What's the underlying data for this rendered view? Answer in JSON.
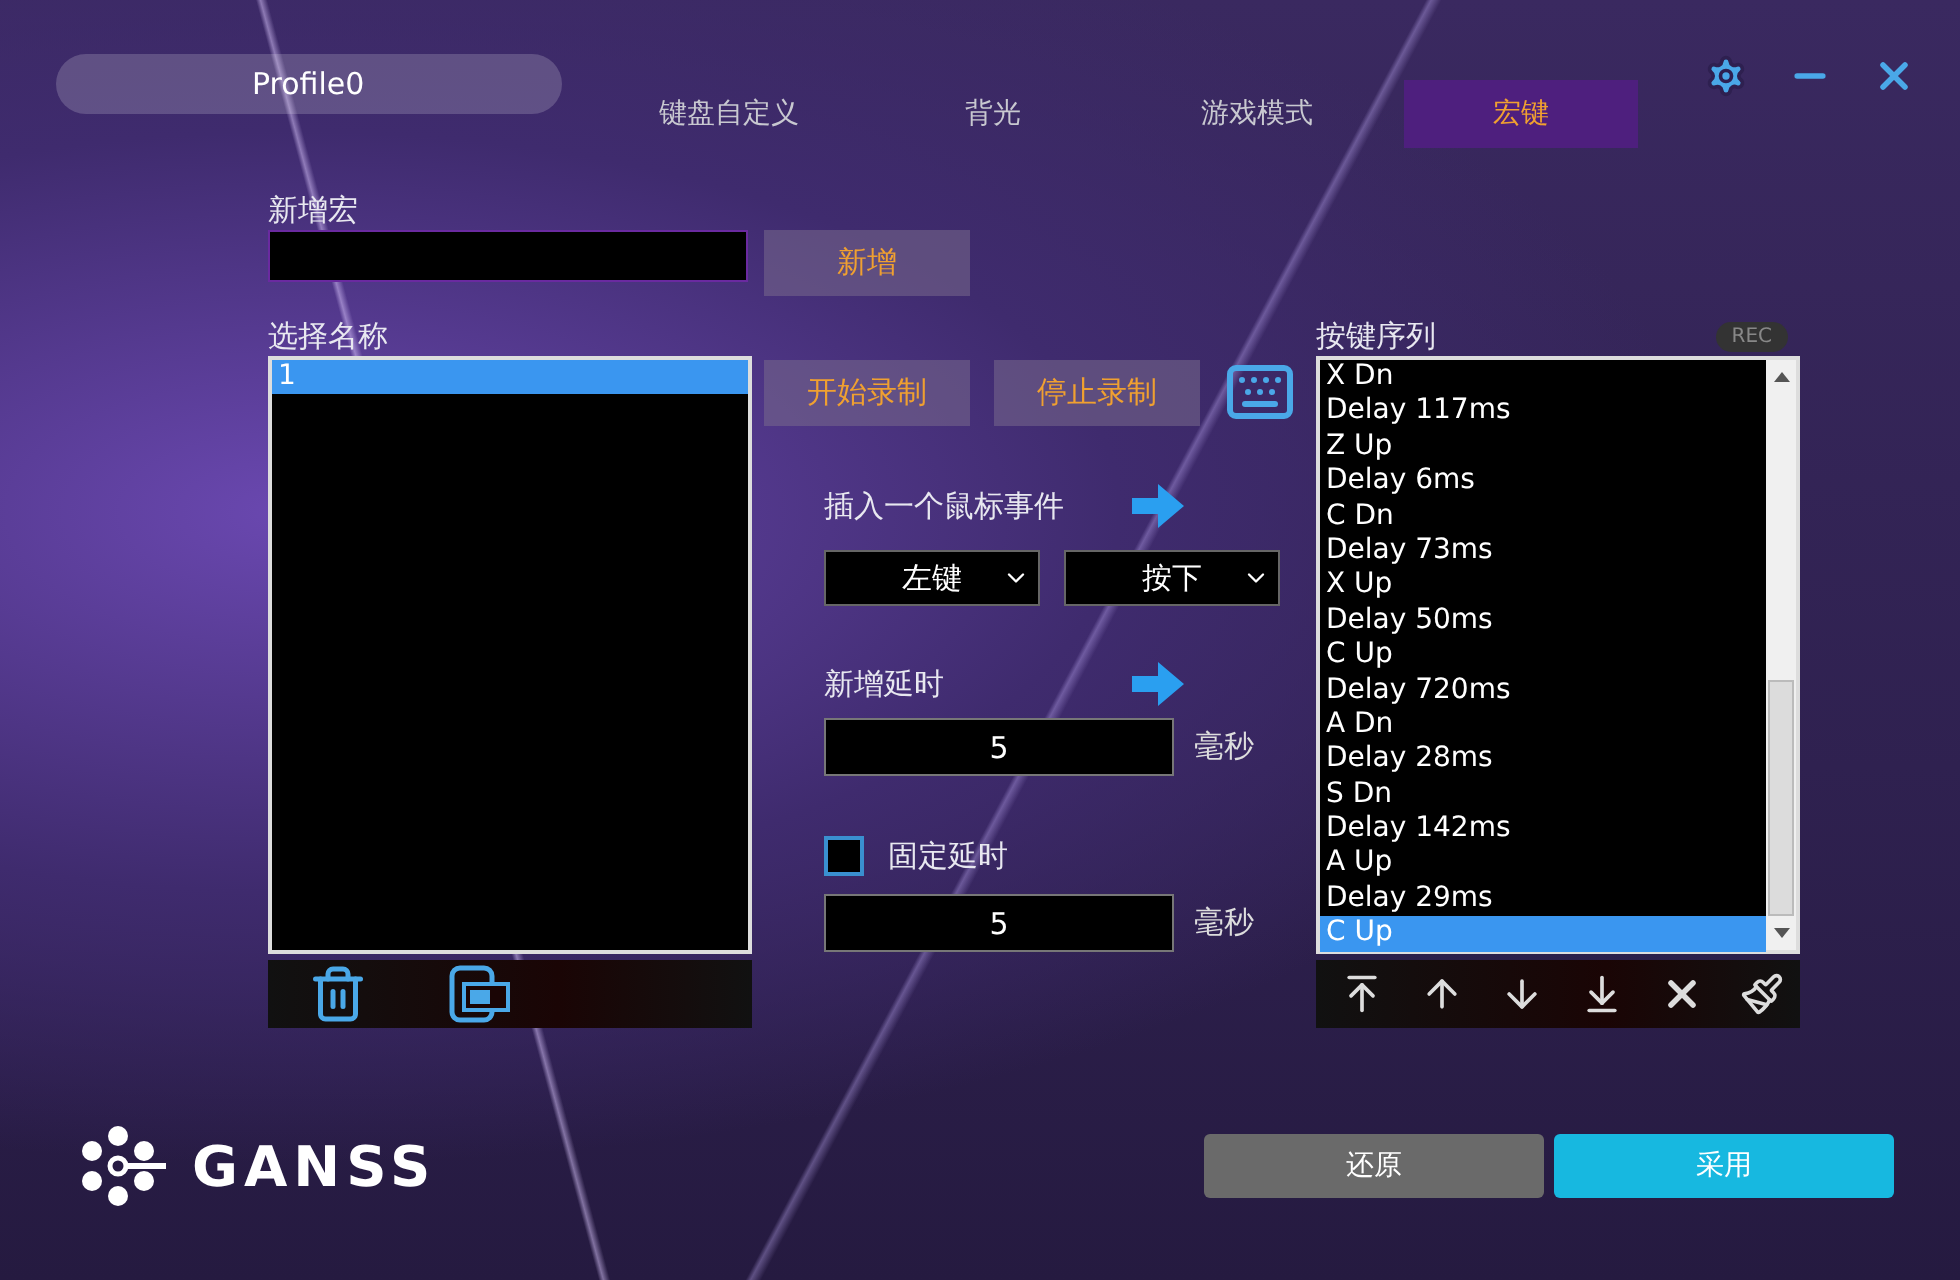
{
  "profile": {
    "name": "Profile0"
  },
  "tabs": [
    {
      "label": "键盘自定义",
      "selected": false
    },
    {
      "label": "背光",
      "selected": false
    },
    {
      "label": "游戏模式",
      "selected": false
    },
    {
      "label": "宏键",
      "selected": true
    }
  ],
  "new_macro": {
    "label": "新增宏",
    "button": "新增"
  },
  "macro_list": {
    "label": "选择名称",
    "items": [
      {
        "label": "1",
        "selected": true
      }
    ]
  },
  "record_buttons": [
    "开始录制",
    "停止录制"
  ],
  "mouse_event": {
    "label": "插入一个鼠标事件",
    "button_select": "左键",
    "action_select": "按下"
  },
  "add_delay": {
    "label": "新增延时",
    "value": "5",
    "unit": "毫秒"
  },
  "fixed_delay": {
    "label": "固定延时",
    "checked": false,
    "value": "5",
    "unit": "毫秒"
  },
  "sequence": {
    "label": "按键序列",
    "badge": "REC",
    "items": [
      {
        "label": "X Dn",
        "selected": false
      },
      {
        "label": "Delay 117ms",
        "selected": false
      },
      {
        "label": "Z Up",
        "selected": false
      },
      {
        "label": "Delay 6ms",
        "selected": false
      },
      {
        "label": "C Dn",
        "selected": false
      },
      {
        "label": "Delay 73ms",
        "selected": false
      },
      {
        "label": "X Up",
        "selected": false
      },
      {
        "label": "Delay 50ms",
        "selected": false
      },
      {
        "label": "C Up",
        "selected": false
      },
      {
        "label": "Delay 720ms",
        "selected": false
      },
      {
        "label": "A Dn",
        "selected": false
      },
      {
        "label": "Delay 28ms",
        "selected": false
      },
      {
        "label": "S Dn",
        "selected": false
      },
      {
        "label": "Delay 142ms",
        "selected": false
      },
      {
        "label": "A Up",
        "selected": false
      },
      {
        "label": "Delay 29ms",
        "selected": false
      },
      {
        "label": "C Up",
        "selected": true
      }
    ]
  },
  "footer": {
    "logo": "GANSS",
    "buttons": [
      {
        "label": "还原",
        "kind": "secondary"
      },
      {
        "label": "采用",
        "kind": "primary"
      }
    ]
  }
}
